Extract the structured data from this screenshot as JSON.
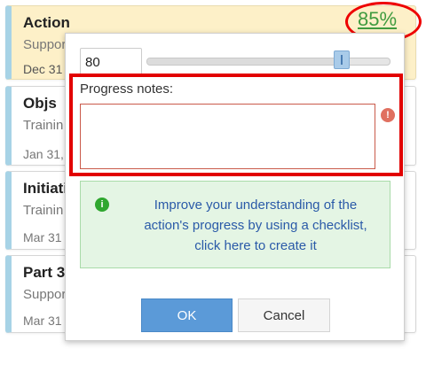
{
  "cards": [
    {
      "title": "Action",
      "subtitle": "Suppor",
      "date": "Dec 31"
    },
    {
      "title": "Objs",
      "subtitle": "Trainin",
      "date": "Jan 31,"
    },
    {
      "title": "Initiati",
      "subtitle": "Trainin",
      "date": "Mar 31"
    },
    {
      "title": "Part 3",
      "subtitle": "Suppor",
      "date": "Mar 31"
    }
  ],
  "progress_percent": "85%",
  "dialog": {
    "progress_value": "80",
    "slider_value": 80,
    "notes_label": "Progress notes:",
    "notes_value": "",
    "error_icon": "!",
    "info_icon": "i",
    "info_message": "Improve your understanding of the action's progress by using a checklist, click here to create it",
    "ok_label": "OK",
    "cancel_label": "Cancel"
  },
  "colors": {
    "highlight_red": "#e00000",
    "ok_blue": "#5b9ad8",
    "percent_green": "#3f9b3f",
    "active_card_bg": "#fdf0c8",
    "info_bg": "#e4f5e4"
  }
}
